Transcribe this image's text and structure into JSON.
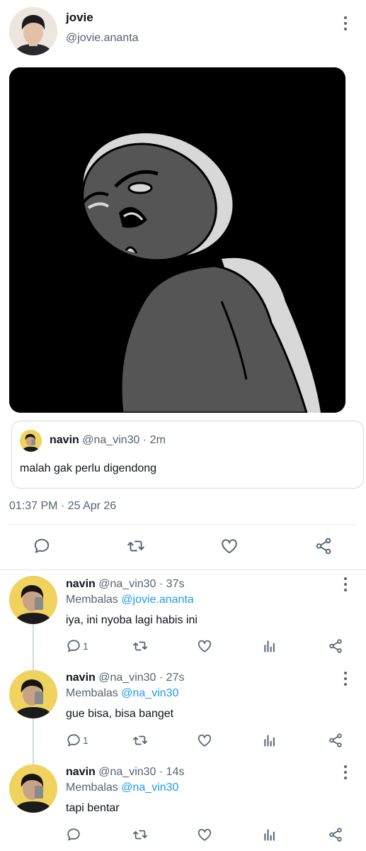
{
  "tweet": {
    "author": {
      "name": "jovie",
      "handle": "@jovie.ananta"
    },
    "media": {
      "description_icon": "meme-image"
    },
    "quote": {
      "name": "navin",
      "handle": "@na_vin30",
      "separator": "·",
      "time": "2m",
      "text": "malah gak perlu digendong"
    },
    "timestamp": "01:37 PM · 25 Apr 26"
  },
  "replies": [
    {
      "name": "navin",
      "handle": "@na_vin30",
      "separator": "·",
      "time": "37s",
      "replying_label": "Membalas",
      "replying_to": "@jovie.ananta",
      "text": "iya, ini nyoba lagi habis ini",
      "reply_count": "1"
    },
    {
      "name": "navin",
      "handle": "@na_vin30",
      "separator": "·",
      "time": "27s",
      "replying_label": "Membalas",
      "replying_to": "@na_vin30",
      "text": "gue bisa, bisa banget",
      "reply_count": "1"
    },
    {
      "name": "navin",
      "handle": "@na_vin30",
      "separator": "·",
      "time": "14s",
      "replying_label": "Membalas",
      "replying_to": "@na_vin30",
      "text": "tapi bentar",
      "reply_count": ""
    }
  ],
  "colors": {
    "text": "#0f1419",
    "muted": "#536471",
    "link": "#1d9bf0",
    "border": "#cfd9de",
    "avatar_bg": "#efd35e"
  }
}
